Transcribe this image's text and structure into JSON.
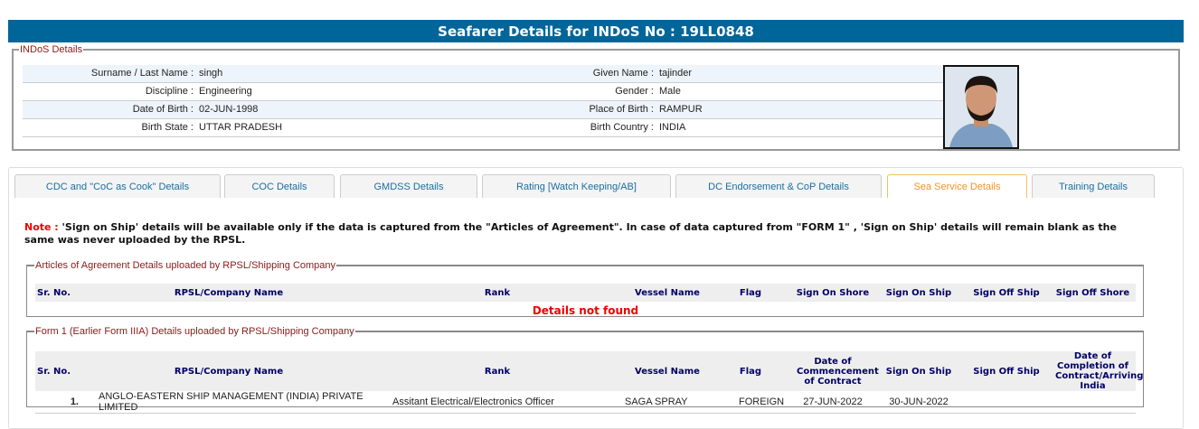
{
  "title": "Seafarer Details for INDoS No : 19LL0848",
  "indos": {
    "legend": "INDoS Details",
    "rows": [
      {
        "l1": "Surname / Last Name :",
        "v1": "singh",
        "l2": "Given Name :",
        "v2": "tajinder"
      },
      {
        "l1": "Discipline :",
        "v1": "Engineering",
        "l2": "Gender :",
        "v2": "Male"
      },
      {
        "l1": "Date of Birth :",
        "v1": "02-JUN-1998",
        "l2": "Place of Birth :",
        "v2": "RAMPUR"
      },
      {
        "l1": "Birth State :",
        "v1": "UTTAR PRADESH",
        "l2": "Birth Country :",
        "v2": "INDIA"
      }
    ]
  },
  "tabs": [
    "CDC and \"CoC as Cook\" Details",
    "COC Details",
    "GMDSS Details",
    "Rating [Watch Keeping/AB]",
    "DC Endorsement & CoP Details",
    "Sea Service Details",
    "Training Details"
  ],
  "note": {
    "label": "Note :",
    "text": " 'Sign on Ship' details will be available only if the data is captured from the \"Articles of Agreement\". In case of data captured from \"FORM 1\" , 'Sign on Ship' details will remain blank as the same was never uploaded by the RPSL."
  },
  "articles": {
    "legend": "Articles of Agreement Details uploaded by RPSL/Shipping Company",
    "headers": [
      "Sr. No.",
      "RPSL/Company Name",
      "Rank",
      "Vessel Name",
      "Flag",
      "Sign On Shore",
      "Sign On Ship",
      "Sign Off Ship",
      "Sign Off Shore"
    ],
    "empty": "Details not found"
  },
  "form1": {
    "legend": "Form 1 (Earlier Form IIIA) Details uploaded by RPSL/Shipping Company",
    "headers": [
      "Sr. No.",
      "RPSL/Company Name",
      "Rank",
      "Vessel Name",
      "Flag",
      "Date of Commencement of Contract",
      "Sign On Ship",
      "Sign Off Ship",
      "Date of Completion of Contract/Arriving India"
    ],
    "rows": [
      [
        "1.",
        "ANGLO-EASTERN SHIP MANAGEMENT (INDIA) PRIVATE LIMITED",
        "Assitant Electrical/Electronics Officer",
        "SAGA SPRAY",
        "FOREIGN",
        "27-JUN-2022",
        "30-JUN-2022",
        "",
        ""
      ]
    ]
  }
}
